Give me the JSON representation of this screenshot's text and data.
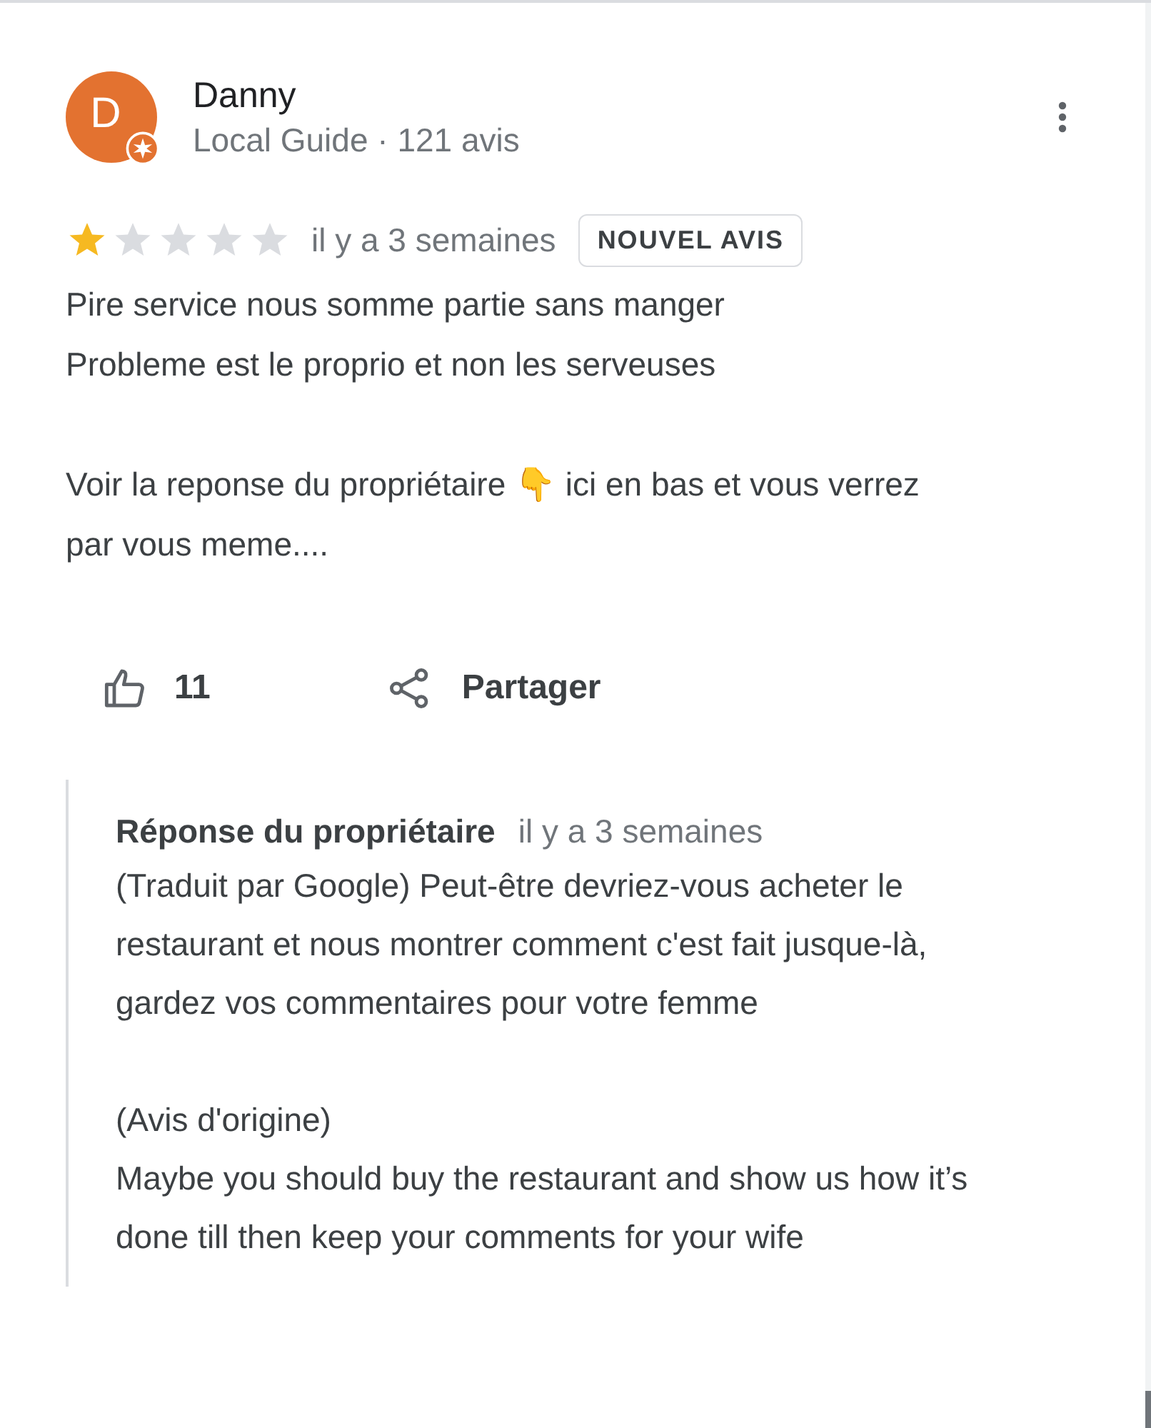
{
  "review": {
    "avatar_letter": "D",
    "author": "Danny",
    "author_meta": "Local Guide · 121 avis",
    "stars": 1,
    "time": "il y a 3 semaines",
    "badge": "NOUVEL AVIS",
    "paragraphs": [
      "Pire service nous somme partie sans manger\nProbleme est le proprio et non les serveuses",
      "Voir la reponse du propriétaire 👇 ici en bas et vous verrez par vous meme...."
    ],
    "likes": "11",
    "share_label": "Partager"
  },
  "owner_reply": {
    "title": "Réponse du propriétaire",
    "time": "il y a 3 semaines",
    "paragraphs": [
      "(Traduit par Google) Peut-être devriez-vous acheter le restaurant et nous montrer comment c'est fait jusque-là, gardez vos commentaires pour votre femme",
      "(Avis d'origine)\nMaybe you should buy the restaurant and show us how it’s done till then keep your comments for your wife"
    ]
  }
}
